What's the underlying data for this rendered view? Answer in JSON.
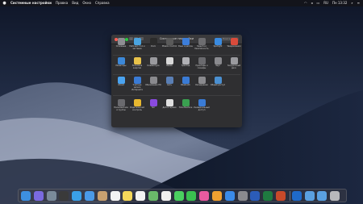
{
  "menubar": {
    "app_name": "Системные настройки",
    "items": [
      "Правка",
      "Вид",
      "Окно",
      "Справка"
    ],
    "status_icons": [
      "wifi-icon",
      "volume-icon",
      "battery-icon"
    ],
    "keyboard_layout": "RU",
    "clock": "Пн 13:32"
  },
  "window": {
    "title": "Системные настройки",
    "search_placeholder": "Поиск",
    "rows": [
      [
        {
          "label": "Основные",
          "icon": "general-icon",
          "color": "#8e8e93"
        },
        {
          "label": "Рабочий стол и заставка",
          "icon": "desktop-icon",
          "color": "#4aa3df"
        },
        {
          "label": "Dock",
          "icon": "dock-icon",
          "color": "#2b2b2b"
        },
        {
          "label": "Mission Control",
          "icon": "mission-control-icon",
          "color": "#5a5a5a"
        },
        {
          "label": "Язык и регион",
          "icon": "language-icon",
          "color": "#3c7dd9"
        },
        {
          "label": "Защита и безопасность",
          "icon": "security-icon",
          "color": "#6d6d70"
        },
        {
          "label": "Spotlight",
          "icon": "spotlight-icon",
          "color": "#3a8be0"
        },
        {
          "label": "Уведомления",
          "icon": "notifications-icon",
          "color": "#d94b3b"
        }
      ],
      [
        {
          "label": "Мониторы",
          "icon": "displays-icon",
          "color": "#3c88d8"
        },
        {
          "label": "Экономия энергии",
          "icon": "energy-icon",
          "color": "#e8c24a"
        },
        {
          "label": "Клавиатура",
          "icon": "keyboard-icon",
          "color": "#9a9a9e"
        },
        {
          "label": "Мышь",
          "icon": "mouse-icon",
          "color": "#d8d8d8"
        },
        {
          "label": "Трекпад",
          "icon": "trackpad-icon",
          "color": "#b0b0b4"
        },
        {
          "label": "Принтеры и сканеры",
          "icon": "printers-icon",
          "color": "#6a6a6e"
        },
        {
          "label": "Звук",
          "icon": "sound-icon",
          "color": "#8a8a8e"
        },
        {
          "label": "Загрузочный диск",
          "icon": "startup-disk-icon",
          "color": "#9a9a9e"
        }
      ],
      [
        {
          "label": "iCloud",
          "icon": "icloud-icon",
          "color": "#4aa3f0"
        },
        {
          "label": "Учетные записи Интернета",
          "icon": "internet-accounts-icon",
          "color": "#3a7bd5"
        },
        {
          "label": "Обновление ПО",
          "icon": "software-update-icon",
          "color": "#8a8a8e"
        },
        {
          "label": "Сеть",
          "icon": "network-icon",
          "color": "#5a7fb5"
        },
        {
          "label": "Bluetooth",
          "icon": "bluetooth-icon",
          "color": "#3a7bd5"
        },
        {
          "label": "Расширения",
          "icon": "extensions-icon",
          "color": "#8a8a8e"
        },
        {
          "label": "Общий доступ",
          "icon": "sharing-icon",
          "color": "#4a8fd0"
        }
      ],
      [
        {
          "label": "Пользователи и группы",
          "icon": "users-icon",
          "color": "#6a6a6e"
        },
        {
          "label": "Родительский контроль",
          "icon": "parental-controls-icon",
          "color": "#e8b830"
        },
        {
          "label": "Siri",
          "icon": "siri-icon",
          "color": "#8a4ae0"
        },
        {
          "label": "Дата и время",
          "icon": "date-time-icon",
          "color": "#e0e0e0"
        },
        {
          "label": "Time Machine",
          "icon": "time-machine-icon",
          "color": "#3aa050"
        },
        {
          "label": "Универсальный доступ",
          "icon": "accessibility-icon",
          "color": "#3a7bd5"
        }
      ]
    ]
  },
  "dock": {
    "apps": [
      {
        "name": "finder-icon",
        "color": "#3d8fe0"
      },
      {
        "name": "siri-icon",
        "color": "#7a6ae0"
      },
      {
        "name": "launchpad-icon",
        "color": "#7a8a9a"
      },
      {
        "name": "mission-control-icon",
        "color": "#3a3a3a"
      },
      {
        "name": "safari-icon",
        "color": "#3aa0e8"
      },
      {
        "name": "mail-icon",
        "color": "#4a9ae8"
      },
      {
        "name": "contacts-icon",
        "color": "#c8a070"
      },
      {
        "name": "calendar-icon",
        "color": "#f2f2f2"
      },
      {
        "name": "notes-icon",
        "color": "#f5d85a"
      },
      {
        "name": "reminders-icon",
        "color": "#f2f2f2"
      },
      {
        "name": "maps-icon",
        "color": "#6ab86a"
      },
      {
        "name": "photos-icon",
        "color": "#f0f0f0"
      },
      {
        "name": "messages-icon",
        "color": "#4ad060"
      },
      {
        "name": "facetime-icon",
        "color": "#3ac050"
      },
      {
        "name": "itunes-icon",
        "color": "#e85aa0"
      },
      {
        "name": "books-icon",
        "color": "#f0a030"
      },
      {
        "name": "app-store-icon",
        "color": "#3a8ae8"
      },
      {
        "name": "system-preferences-icon",
        "color": "#8a8a8e"
      },
      {
        "name": "word-icon",
        "color": "#2b5cb8"
      },
      {
        "name": "excel-icon",
        "color": "#1f7a40"
      },
      {
        "name": "powerpoint-icon",
        "color": "#c84a2a"
      },
      {
        "name": "outlook-icon",
        "color": "#1f6ac8"
      },
      {
        "name": "downloads-folder-icon",
        "color": "#5aa0e0"
      },
      {
        "name": "documents-folder-icon",
        "color": "#5aa0e0"
      },
      {
        "name": "trash-icon",
        "color": "#b8b8bc"
      }
    ]
  }
}
